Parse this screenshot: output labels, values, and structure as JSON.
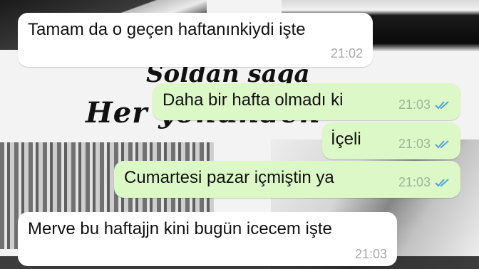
{
  "wallpaper": {
    "script_line1": "Soldan sağa",
    "script_line2": "Her yönünden"
  },
  "messages": [
    {
      "direction": "incoming",
      "text": "Tamam da o geçen haftanınkiydi işte",
      "time": "21:02",
      "status": ""
    },
    {
      "direction": "outgoing",
      "text": "Daha bir hafta olmadı ki",
      "time": "21:03",
      "status": "read-double-check-icon"
    },
    {
      "direction": "outgoing",
      "text": "İçeli",
      "time": "21:03",
      "status": "read-double-check-icon"
    },
    {
      "direction": "outgoing",
      "text": "Cumartesi pazar içmiştin ya",
      "time": "21:03",
      "status": "read-double-check-icon"
    },
    {
      "direction": "incoming",
      "text": "Merve bu haftajjn kini bugün icecem işte",
      "time": "21:03",
      "status": ""
    }
  ],
  "colors": {
    "incoming_bubble": "#ffffff",
    "outgoing_bubble": "#dcf8c6",
    "read_ticks": "#4fa3e0"
  }
}
